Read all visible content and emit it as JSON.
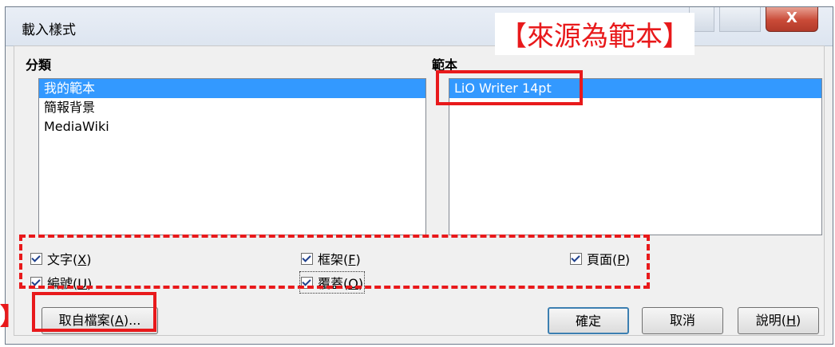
{
  "dialog": {
    "title": "載入樣式",
    "close_label": "X"
  },
  "labels": {
    "category": "分類",
    "template": "範本"
  },
  "categories": [
    {
      "label": "我的範本",
      "selected": true
    },
    {
      "label": "簡報背景",
      "selected": false
    },
    {
      "label": "MediaWiki",
      "selected": false
    }
  ],
  "templates": [
    {
      "label": "LiO Writer 14pt",
      "selected": true
    }
  ],
  "checkboxes": {
    "text": {
      "label": "文字",
      "mnemonic": "X",
      "checked": true
    },
    "frame": {
      "label": "框架",
      "mnemonic": "F",
      "checked": true
    },
    "page": {
      "label": "頁面",
      "mnemonic": "P",
      "checked": true
    },
    "numbering": {
      "label": "編號",
      "mnemonic": "U",
      "checked": true
    },
    "overwrite": {
      "label": "覆蓋",
      "mnemonic": "O",
      "checked": true
    }
  },
  "buttons": {
    "from_file": {
      "label": "取自檔案",
      "mnemonic": "A",
      "suffix": "..."
    },
    "ok": {
      "label": "確定"
    },
    "cancel": {
      "label": "取消"
    },
    "help": {
      "label": "說明",
      "mnemonic": "H"
    }
  },
  "annotation": {
    "text": "【來源為範本】",
    "left_mark": "】"
  },
  "colors": {
    "selection": "#3399ff",
    "annotation_red": "#e8191b"
  }
}
